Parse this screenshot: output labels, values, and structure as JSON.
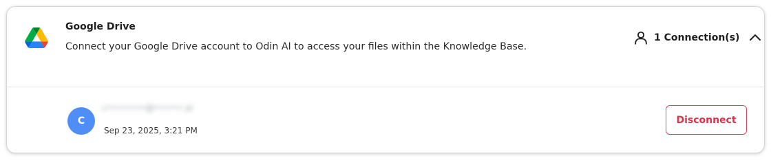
{
  "integration": {
    "name": "Google Drive",
    "description": "Connect your Google Drive account to Odin AI to access your files within the Knowledge Base.",
    "logo_icon": "google-drive-logo-icon",
    "connections_label": "1 Connection(s)",
    "connections_icon": "user-icon",
    "toggle_icon": "chevron-up-icon"
  },
  "connection": {
    "avatar_initial": "C",
    "avatar_color": "#4f8df7",
    "email": "c••••••••@••••••.ai",
    "timestamp": "Sep 23, 2025, 3:21 PM",
    "disconnect_label": "Disconnect",
    "disconnect_color": "#d9324a"
  }
}
